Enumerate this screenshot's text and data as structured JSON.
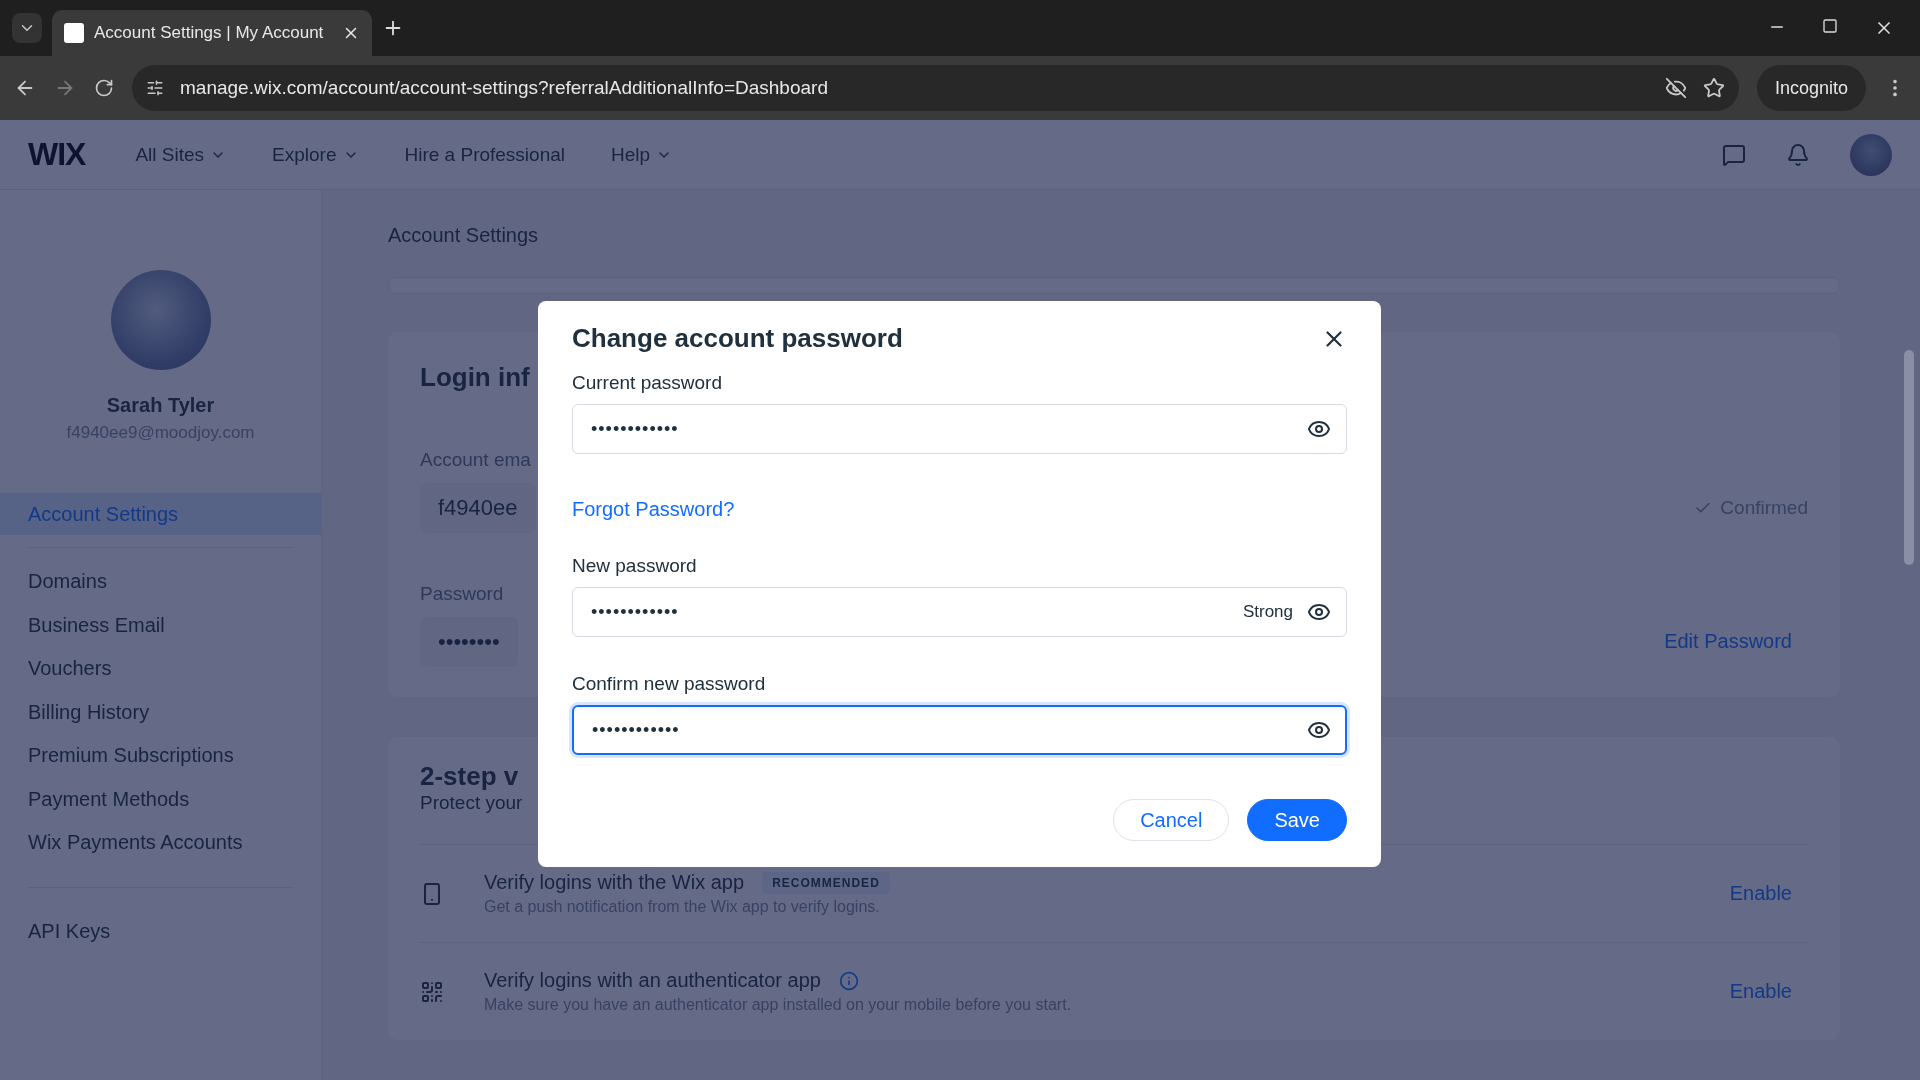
{
  "browser": {
    "tabs": [
      {
        "title": "Account Settings | My Account",
        "selected": true
      }
    ],
    "address": "manage.wix.com/account/account-settings?referralAdditionalInfo=Dashboard",
    "profile": "Incognito"
  },
  "header": {
    "logo": "WIX",
    "nav": [
      {
        "label": "All Sites",
        "dropdown": true
      },
      {
        "label": "Explore",
        "dropdown": true
      },
      {
        "label": "Hire a Professional",
        "dropdown": false
      },
      {
        "label": "Help",
        "dropdown": true
      }
    ]
  },
  "sidebar": {
    "name": "Sarah Tyler",
    "email": "f4940ee9@moodjoy.com",
    "sections": [
      [
        {
          "label": "Account Settings",
          "selected": true
        }
      ],
      [
        {
          "label": "Domains",
          "selected": false
        },
        {
          "label": "Business Email",
          "selected": false
        },
        {
          "label": "Vouchers",
          "selected": false
        },
        {
          "label": "Billing History",
          "selected": false
        },
        {
          "label": "Premium Subscriptions",
          "selected": false
        },
        {
          "label": "Payment Methods",
          "selected": false
        },
        {
          "label": "Wix Payments Accounts",
          "selected": false
        }
      ],
      [
        {
          "label": "API Keys",
          "selected": false
        }
      ]
    ]
  },
  "main": {
    "breadcrumb": "Account Settings",
    "login": {
      "heading": "Login inf",
      "email_label": "Account ema",
      "email_value": "f4940ee",
      "status": "Confirmed",
      "password_label": "Password",
      "password_value": "••••••••",
      "edit": "Edit Password"
    },
    "two_step": {
      "heading": "2-step v",
      "subtitle": "Protect your",
      "methods": [
        {
          "kind": "phone",
          "title": "Verify logins with the Wix app",
          "badge": "RECOMMENDED",
          "info": false,
          "description": "Get a push notification from the Wix app to verify logins.",
          "action": "Enable"
        },
        {
          "kind": "qr",
          "title": "Verify logins with an authenticator app",
          "info": true,
          "description": "Make sure you have an authenticator app installed on your mobile before you start.",
          "action": "Enable"
        }
      ]
    }
  },
  "modal": {
    "title": "Change account password",
    "fields": [
      {
        "kind": "field",
        "label": "Current password",
        "value": "••••••••••••",
        "focused": false
      },
      {
        "kind": "link",
        "label": "Forgot Password?"
      },
      {
        "kind": "field",
        "label": "New password",
        "value": "••••••••••••",
        "strength": "Strong",
        "focused": false
      },
      {
        "kind": "field",
        "label": "Confirm new password",
        "value": "••••••••••••",
        "focused": true
      }
    ],
    "cancel": "Cancel",
    "save": "Save"
  }
}
